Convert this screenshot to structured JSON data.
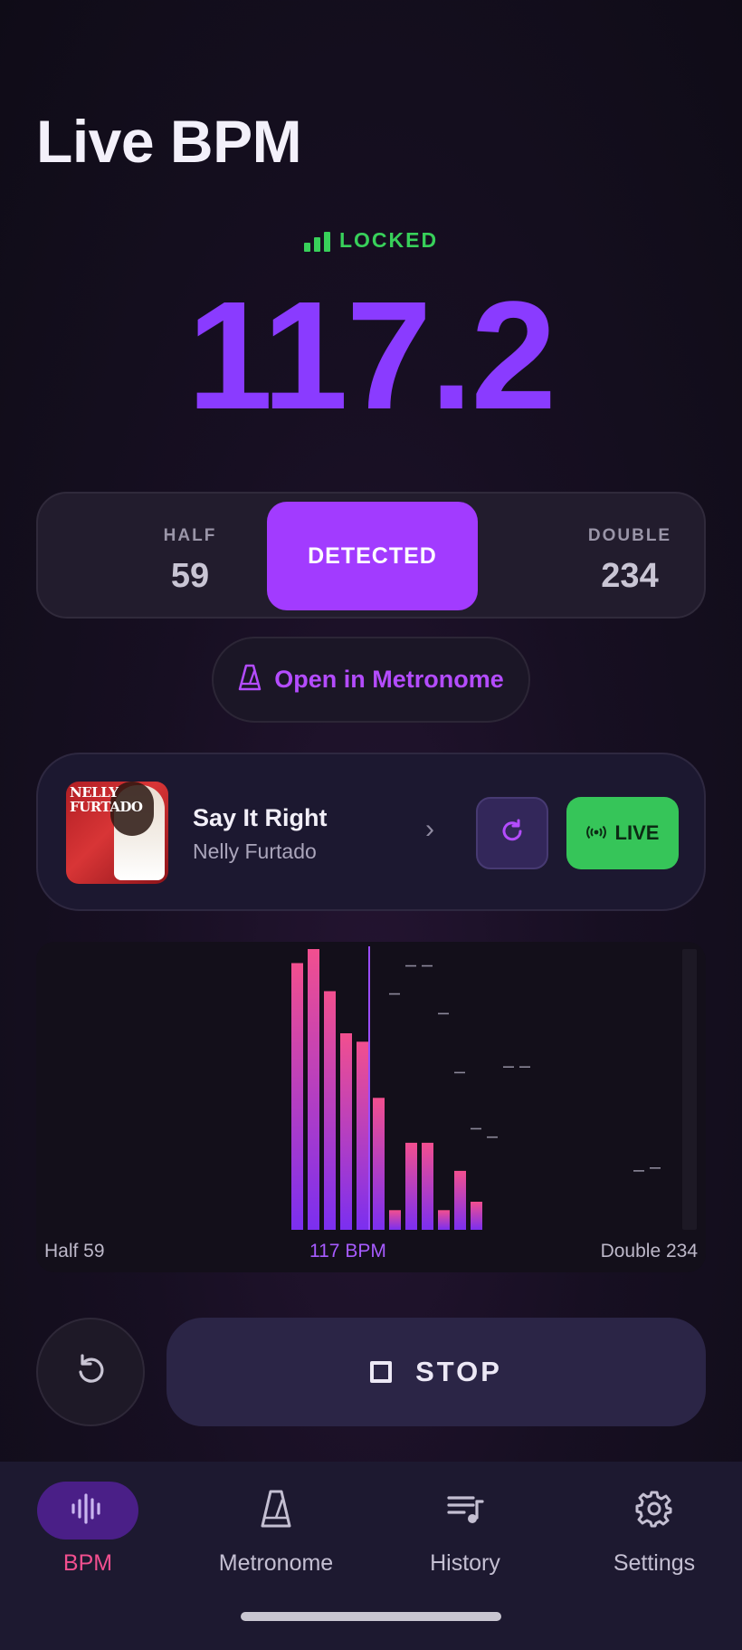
{
  "page": {
    "title": "Live BPM"
  },
  "lock": {
    "label": "LOCKED",
    "icon": "signal-bars-icon",
    "color": "#38d05a"
  },
  "bpm": {
    "value": "117.2",
    "color": "#8a3bff"
  },
  "multiplier": {
    "half_label": "HALF",
    "half_value": "59",
    "detected_label": "DETECTED",
    "double_label": "DOUBLE",
    "double_value": "234",
    "accent": "#a23bff"
  },
  "metronome_link": {
    "label": "Open in Metronome",
    "icon": "metronome-icon"
  },
  "track": {
    "title": "Say It Right",
    "artist": "Nelly Furtado",
    "art_text": "NELLY FURTADO",
    "refresh_icon": "refresh-icon",
    "live_label": "LIVE",
    "live_icon": "broadcast-icon"
  },
  "histogram": {
    "half_label": "Half 59",
    "center_label": "117 BPM",
    "double_label": "Double 234",
    "bars": [
      0.95,
      1.0,
      0.85,
      0.7,
      0.67,
      0.47,
      0.07,
      0.31,
      0.31,
      0.07,
      0.21,
      0.1
    ],
    "peaks": [
      {
        "slot": 6,
        "level": 0.84
      },
      {
        "slot": 7,
        "level": 0.94
      },
      {
        "slot": 8,
        "level": 0.94
      },
      {
        "slot": 9,
        "level": 0.77
      },
      {
        "slot": 10,
        "level": 0.56
      },
      {
        "slot": 11,
        "level": 0.36
      },
      {
        "slot": 12,
        "level": 0.33
      },
      {
        "slot": 13,
        "level": 0.58
      },
      {
        "slot": 14,
        "level": 0.58
      },
      {
        "slot": 21,
        "level": 0.21
      },
      {
        "slot": 22,
        "level": 0.22
      }
    ],
    "bar_color_top": "#f24f8f",
    "bar_color_bottom": "#7b2ff0"
  },
  "controls": {
    "stop_label": "STOP",
    "reset_icon": "reset-icon",
    "stop_icon": "stop-square-icon"
  },
  "nav": [
    {
      "label": "BPM",
      "icon": "waveform-icon",
      "active": true
    },
    {
      "label": "Metronome",
      "icon": "metronome-icon",
      "active": false
    },
    {
      "label": "History",
      "icon": "playlist-icon",
      "active": false
    },
    {
      "label": "Settings",
      "icon": "gear-icon",
      "active": false
    }
  ]
}
